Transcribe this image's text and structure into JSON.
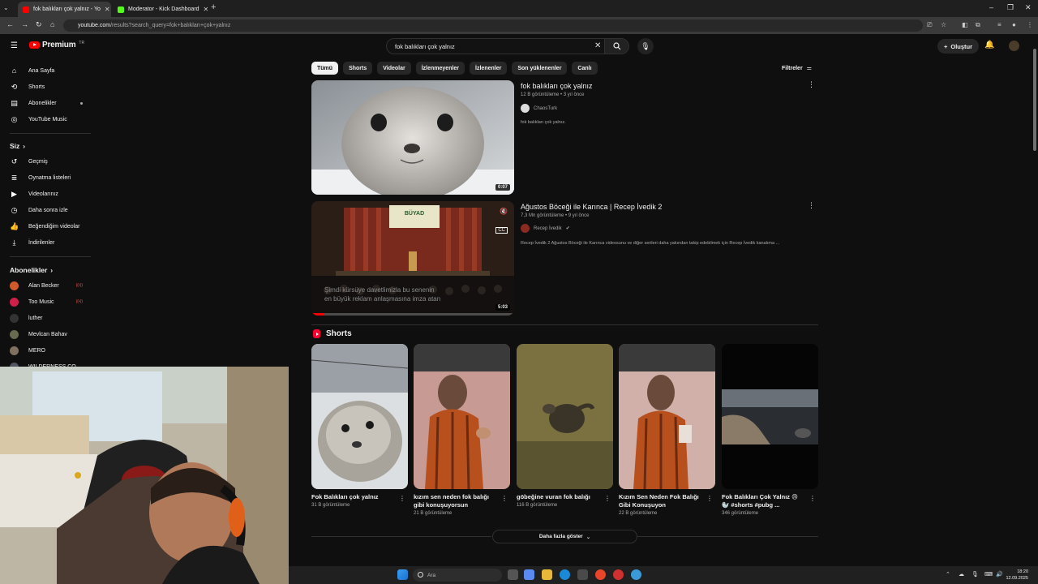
{
  "browser": {
    "tabs": [
      {
        "label": "fok balıkları çok yalnız - Yo",
        "active": true
      },
      {
        "label": "Moderator - Kick Dashboard",
        "active": false
      }
    ],
    "url_host": "youtube.com",
    "url_path": "/results?search_query=fok+balıkları+çok+yalnız"
  },
  "masthead": {
    "logo_text": "Premium",
    "logo_region": "TR",
    "search_value": "fok balıkları çok yalnız",
    "create_label": "Oluştur"
  },
  "sidebar": {
    "main": [
      {
        "label": "Ana Sayfa",
        "icon": "home-icon"
      },
      {
        "label": "Shorts",
        "icon": "shorts-icon"
      },
      {
        "label": "Abonelikler",
        "icon": "subscriptions-icon"
      },
      {
        "label": "YouTube Music",
        "icon": "music-icon"
      }
    ],
    "you_heading": "Siz",
    "you_items": [
      {
        "label": "Geçmiş",
        "icon": "history-icon"
      },
      {
        "label": "Oynatma listeleri",
        "icon": "playlist-icon"
      },
      {
        "label": "Videolarınız",
        "icon": "your-videos-icon"
      },
      {
        "label": "Daha sonra izle",
        "icon": "watch-later-icon"
      },
      {
        "label": "Beğendiğim videolar",
        "icon": "like-icon"
      },
      {
        "label": "İndirilenler",
        "icon": "download-icon"
      }
    ],
    "subs_heading": "Abonelikler",
    "subs": [
      {
        "label": "Alan Becker",
        "color": "#d05a2a",
        "live": "((•))"
      },
      {
        "label": "Too Music",
        "color": "#d0204a",
        "live": "((•))"
      },
      {
        "label": "luther",
        "color": "#222222"
      },
      {
        "label": "Mevlcan Bahav",
        "color": "#6a6a50"
      },
      {
        "label": "MERO",
        "color": "#807060"
      },
      {
        "label": "WILDERNESS CO",
        "color": "#505560"
      }
    ]
  },
  "chips": [
    "Tümü",
    "Shorts",
    "Videolar",
    "İzlenmeyenler",
    "İzlenenler",
    "Son yüklenenler",
    "Canlı"
  ],
  "filters_label": "Filtreler",
  "videos": [
    {
      "title": "fok balıkları çok yalnız",
      "meta": "12 B görüntüleme • 3 yıl önce",
      "channel": "ChaosTurk",
      "description": "fok balıkları çok yalnız.",
      "duration": "0:07"
    },
    {
      "title": "Ağustos Böceği ile Karınca | Recep İvedik 2",
      "meta": "7,3 Mn görüntüleme • 9 yıl önce",
      "channel": "Recep İvedik",
      "verified": "✔",
      "description": "Recep İvedik 2 Ağustos Böceği ile Karınca videosunu ve diğer serileri daha yakından takip edebilmek için Recep İvedik kanalıma ...",
      "duration": "5:03",
      "caption_line1": "Şimdi kürsüye davetlimizla bu senenin",
      "caption_line2": "en büyük reklam anlaşmasına imza atan",
      "banner": "BÜYAD",
      "progress": 0.06
    }
  ],
  "shorts": {
    "heading": "Shorts",
    "items": [
      {
        "title": "Fok Balıkları çok yalnız",
        "views": "31 B görüntüleme"
      },
      {
        "title": "kızım sen neden fok balığı gibi konuşuyorsun",
        "views": "21 B görüntüleme"
      },
      {
        "title": "göbeğine vuran fok balığı",
        "views": "116 B görüntüleme"
      },
      {
        "title": "Kızım Sen Neden Fok Balığı Gibi Konuşuyon",
        "views": "22 B görüntüleme"
      },
      {
        "title": "Fok Balıkları Çok Yalnız 😢 🦭 #shorts #pubg ...",
        "views": "346 görüntüleme"
      }
    ],
    "show_more": "Daha fazla göster"
  },
  "taskbar": {
    "search_placeholder": "Ara",
    "time": "18:20",
    "date": "12.09.2025"
  }
}
